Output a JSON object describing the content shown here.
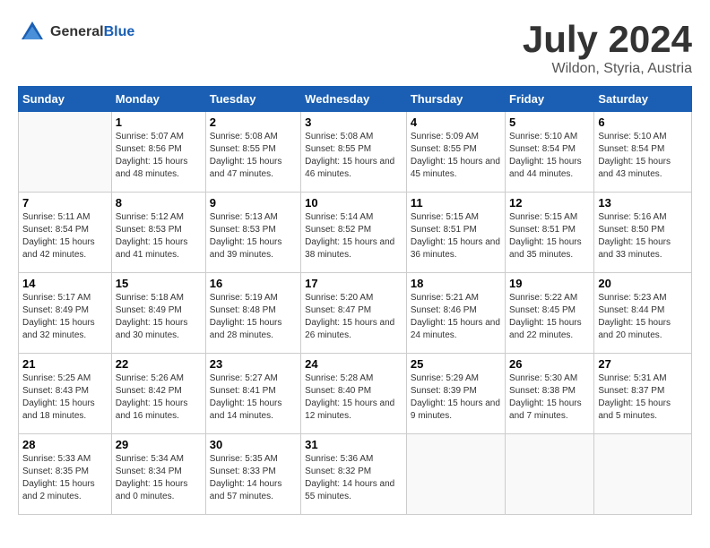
{
  "logo": {
    "general": "General",
    "blue": "Blue"
  },
  "header": {
    "title": "July 2024",
    "subtitle": "Wildon, Styria, Austria"
  },
  "weekdays": [
    "Sunday",
    "Monday",
    "Tuesday",
    "Wednesday",
    "Thursday",
    "Friday",
    "Saturday"
  ],
  "weeks": [
    [
      {
        "day": "",
        "empty": true
      },
      {
        "day": "1",
        "sunrise": "Sunrise: 5:07 AM",
        "sunset": "Sunset: 8:56 PM",
        "daylight": "Daylight: 15 hours and 48 minutes."
      },
      {
        "day": "2",
        "sunrise": "Sunrise: 5:08 AM",
        "sunset": "Sunset: 8:55 PM",
        "daylight": "Daylight: 15 hours and 47 minutes."
      },
      {
        "day": "3",
        "sunrise": "Sunrise: 5:08 AM",
        "sunset": "Sunset: 8:55 PM",
        "daylight": "Daylight: 15 hours and 46 minutes."
      },
      {
        "day": "4",
        "sunrise": "Sunrise: 5:09 AM",
        "sunset": "Sunset: 8:55 PM",
        "daylight": "Daylight: 15 hours and 45 minutes."
      },
      {
        "day": "5",
        "sunrise": "Sunrise: 5:10 AM",
        "sunset": "Sunset: 8:54 PM",
        "daylight": "Daylight: 15 hours and 44 minutes."
      },
      {
        "day": "6",
        "sunrise": "Sunrise: 5:10 AM",
        "sunset": "Sunset: 8:54 PM",
        "daylight": "Daylight: 15 hours and 43 minutes."
      }
    ],
    [
      {
        "day": "7",
        "sunrise": "Sunrise: 5:11 AM",
        "sunset": "Sunset: 8:54 PM",
        "daylight": "Daylight: 15 hours and 42 minutes."
      },
      {
        "day": "8",
        "sunrise": "Sunrise: 5:12 AM",
        "sunset": "Sunset: 8:53 PM",
        "daylight": "Daylight: 15 hours and 41 minutes."
      },
      {
        "day": "9",
        "sunrise": "Sunrise: 5:13 AM",
        "sunset": "Sunset: 8:53 PM",
        "daylight": "Daylight: 15 hours and 39 minutes."
      },
      {
        "day": "10",
        "sunrise": "Sunrise: 5:14 AM",
        "sunset": "Sunset: 8:52 PM",
        "daylight": "Daylight: 15 hours and 38 minutes."
      },
      {
        "day": "11",
        "sunrise": "Sunrise: 5:15 AM",
        "sunset": "Sunset: 8:51 PM",
        "daylight": "Daylight: 15 hours and 36 minutes."
      },
      {
        "day": "12",
        "sunrise": "Sunrise: 5:15 AM",
        "sunset": "Sunset: 8:51 PM",
        "daylight": "Daylight: 15 hours and 35 minutes."
      },
      {
        "day": "13",
        "sunrise": "Sunrise: 5:16 AM",
        "sunset": "Sunset: 8:50 PM",
        "daylight": "Daylight: 15 hours and 33 minutes."
      }
    ],
    [
      {
        "day": "14",
        "sunrise": "Sunrise: 5:17 AM",
        "sunset": "Sunset: 8:49 PM",
        "daylight": "Daylight: 15 hours and 32 minutes."
      },
      {
        "day": "15",
        "sunrise": "Sunrise: 5:18 AM",
        "sunset": "Sunset: 8:49 PM",
        "daylight": "Daylight: 15 hours and 30 minutes."
      },
      {
        "day": "16",
        "sunrise": "Sunrise: 5:19 AM",
        "sunset": "Sunset: 8:48 PM",
        "daylight": "Daylight: 15 hours and 28 minutes."
      },
      {
        "day": "17",
        "sunrise": "Sunrise: 5:20 AM",
        "sunset": "Sunset: 8:47 PM",
        "daylight": "Daylight: 15 hours and 26 minutes."
      },
      {
        "day": "18",
        "sunrise": "Sunrise: 5:21 AM",
        "sunset": "Sunset: 8:46 PM",
        "daylight": "Daylight: 15 hours and 24 minutes."
      },
      {
        "day": "19",
        "sunrise": "Sunrise: 5:22 AM",
        "sunset": "Sunset: 8:45 PM",
        "daylight": "Daylight: 15 hours and 22 minutes."
      },
      {
        "day": "20",
        "sunrise": "Sunrise: 5:23 AM",
        "sunset": "Sunset: 8:44 PM",
        "daylight": "Daylight: 15 hours and 20 minutes."
      }
    ],
    [
      {
        "day": "21",
        "sunrise": "Sunrise: 5:25 AM",
        "sunset": "Sunset: 8:43 PM",
        "daylight": "Daylight: 15 hours and 18 minutes."
      },
      {
        "day": "22",
        "sunrise": "Sunrise: 5:26 AM",
        "sunset": "Sunset: 8:42 PM",
        "daylight": "Daylight: 15 hours and 16 minutes."
      },
      {
        "day": "23",
        "sunrise": "Sunrise: 5:27 AM",
        "sunset": "Sunset: 8:41 PM",
        "daylight": "Daylight: 15 hours and 14 minutes."
      },
      {
        "day": "24",
        "sunrise": "Sunrise: 5:28 AM",
        "sunset": "Sunset: 8:40 PM",
        "daylight": "Daylight: 15 hours and 12 minutes."
      },
      {
        "day": "25",
        "sunrise": "Sunrise: 5:29 AM",
        "sunset": "Sunset: 8:39 PM",
        "daylight": "Daylight: 15 hours and 9 minutes."
      },
      {
        "day": "26",
        "sunrise": "Sunrise: 5:30 AM",
        "sunset": "Sunset: 8:38 PM",
        "daylight": "Daylight: 15 hours and 7 minutes."
      },
      {
        "day": "27",
        "sunrise": "Sunrise: 5:31 AM",
        "sunset": "Sunset: 8:37 PM",
        "daylight": "Daylight: 15 hours and 5 minutes."
      }
    ],
    [
      {
        "day": "28",
        "sunrise": "Sunrise: 5:33 AM",
        "sunset": "Sunset: 8:35 PM",
        "daylight": "Daylight: 15 hours and 2 minutes."
      },
      {
        "day": "29",
        "sunrise": "Sunrise: 5:34 AM",
        "sunset": "Sunset: 8:34 PM",
        "daylight": "Daylight: 15 hours and 0 minutes."
      },
      {
        "day": "30",
        "sunrise": "Sunrise: 5:35 AM",
        "sunset": "Sunset: 8:33 PM",
        "daylight": "Daylight: 14 hours and 57 minutes."
      },
      {
        "day": "31",
        "sunrise": "Sunrise: 5:36 AM",
        "sunset": "Sunset: 8:32 PM",
        "daylight": "Daylight: 14 hours and 55 minutes."
      },
      {
        "day": "",
        "empty": true
      },
      {
        "day": "",
        "empty": true
      },
      {
        "day": "",
        "empty": true
      }
    ]
  ]
}
